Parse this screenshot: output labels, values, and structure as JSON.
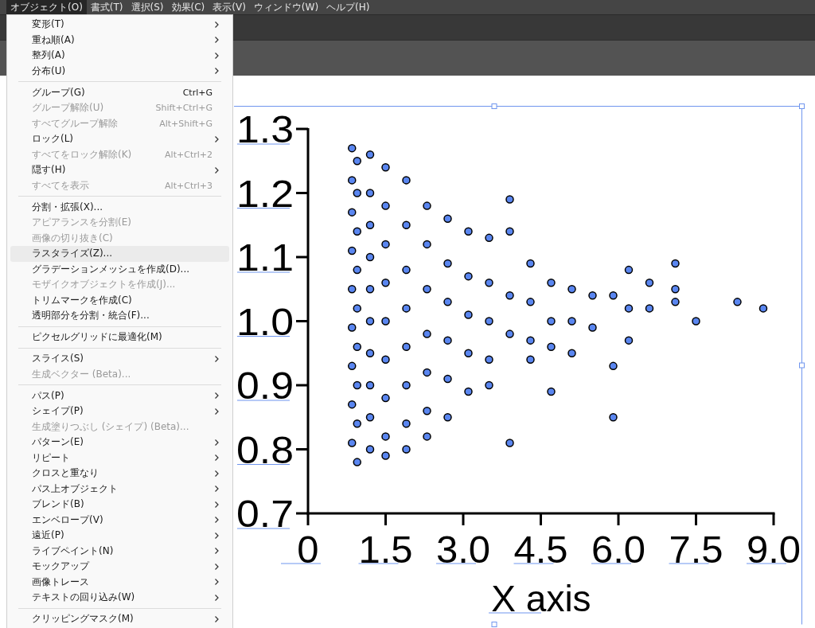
{
  "menubar": [
    {
      "label": "オブジェクト(O)",
      "selected": true
    },
    {
      "label": "書式(T)",
      "selected": false
    },
    {
      "label": "選択(S)",
      "selected": false
    },
    {
      "label": "効果(C)",
      "selected": false
    },
    {
      "label": "表示(V)",
      "selected": false
    },
    {
      "label": "ウィンドウ(W)",
      "selected": false
    },
    {
      "label": "ヘルプ(H)",
      "selected": false
    }
  ],
  "object_menu": [
    {
      "kind": "item",
      "label": "変形(T)",
      "submenu": true,
      "disabled": false,
      "selected": false
    },
    {
      "kind": "item",
      "label": "重ね順(A)",
      "submenu": true,
      "disabled": false,
      "selected": false
    },
    {
      "kind": "item",
      "label": "整列(A)",
      "submenu": true,
      "disabled": false,
      "selected": false
    },
    {
      "kind": "item",
      "label": "分布(U)",
      "submenu": true,
      "disabled": false,
      "selected": false
    },
    {
      "kind": "separator"
    },
    {
      "kind": "item",
      "label": "グループ(G)",
      "shortcut": "Ctrl+G",
      "submenu": false,
      "disabled": false,
      "selected": false
    },
    {
      "kind": "item",
      "label": "グループ解除(U)",
      "shortcut": "Shift+Ctrl+G",
      "submenu": false,
      "disabled": true,
      "selected": false
    },
    {
      "kind": "item",
      "label": "すべてグループ解除",
      "shortcut": "Alt+Shift+G",
      "submenu": false,
      "disabled": true,
      "selected": false
    },
    {
      "kind": "item",
      "label": "ロック(L)",
      "submenu": true,
      "disabled": false,
      "selected": false
    },
    {
      "kind": "item",
      "label": "すべてをロック解除(K)",
      "shortcut": "Alt+Ctrl+2",
      "submenu": false,
      "disabled": true,
      "selected": false
    },
    {
      "kind": "item",
      "label": "隠す(H)",
      "submenu": true,
      "disabled": false,
      "selected": false
    },
    {
      "kind": "item",
      "label": "すべてを表示",
      "shortcut": "Alt+Ctrl+3",
      "submenu": false,
      "disabled": true,
      "selected": false
    },
    {
      "kind": "separator"
    },
    {
      "kind": "item",
      "label": "分割・拡張(X)...",
      "submenu": false,
      "disabled": false,
      "selected": false
    },
    {
      "kind": "item",
      "label": "アピアランスを分割(E)",
      "submenu": false,
      "disabled": true,
      "selected": false
    },
    {
      "kind": "item",
      "label": "画像の切り抜き(C)",
      "submenu": false,
      "disabled": true,
      "selected": false
    },
    {
      "kind": "item",
      "label": "ラスタライズ(Z)...",
      "submenu": false,
      "disabled": false,
      "selected": true
    },
    {
      "kind": "item",
      "label": "グラデーションメッシュを作成(D)...",
      "submenu": false,
      "disabled": false,
      "selected": false
    },
    {
      "kind": "item",
      "label": "モザイクオブジェクトを作成(J)...",
      "submenu": false,
      "disabled": true,
      "selected": false
    },
    {
      "kind": "item",
      "label": "トリムマークを作成(C)",
      "submenu": false,
      "disabled": false,
      "selected": false
    },
    {
      "kind": "item",
      "label": "透明部分を分割・統合(F)...",
      "submenu": false,
      "disabled": false,
      "selected": false
    },
    {
      "kind": "separator"
    },
    {
      "kind": "item",
      "label": "ピクセルグリッドに最適化(M)",
      "submenu": false,
      "disabled": false,
      "selected": false
    },
    {
      "kind": "separator"
    },
    {
      "kind": "item",
      "label": "スライス(S)",
      "submenu": true,
      "disabled": false,
      "selected": false
    },
    {
      "kind": "item",
      "label": "生成ベクター (Beta)...",
      "submenu": false,
      "disabled": true,
      "selected": false
    },
    {
      "kind": "separator"
    },
    {
      "kind": "item",
      "label": "パス(P)",
      "submenu": true,
      "disabled": false,
      "selected": false
    },
    {
      "kind": "item",
      "label": "シェイプ(P)",
      "submenu": true,
      "disabled": false,
      "selected": false
    },
    {
      "kind": "item",
      "label": "生成塗りつぶし (シェイプ) (Beta)...",
      "submenu": false,
      "disabled": true,
      "selected": false
    },
    {
      "kind": "item",
      "label": "パターン(E)",
      "submenu": true,
      "disabled": false,
      "selected": false
    },
    {
      "kind": "item",
      "label": "リピート",
      "submenu": true,
      "disabled": false,
      "selected": false
    },
    {
      "kind": "item",
      "label": "クロスと重なり",
      "submenu": true,
      "disabled": false,
      "selected": false
    },
    {
      "kind": "item",
      "label": "パス上オブジェクト",
      "submenu": true,
      "disabled": false,
      "selected": false
    },
    {
      "kind": "item",
      "label": "ブレンド(B)",
      "submenu": true,
      "disabled": false,
      "selected": false
    },
    {
      "kind": "item",
      "label": "エンベロープ(V)",
      "submenu": true,
      "disabled": false,
      "selected": false
    },
    {
      "kind": "item",
      "label": "遠近(P)",
      "submenu": true,
      "disabled": false,
      "selected": false
    },
    {
      "kind": "item",
      "label": "ライブペイント(N)",
      "submenu": true,
      "disabled": false,
      "selected": false
    },
    {
      "kind": "item",
      "label": "モックアップ",
      "submenu": true,
      "disabled": false,
      "selected": false
    },
    {
      "kind": "item",
      "label": "画像トレース",
      "submenu": true,
      "disabled": false,
      "selected": false
    },
    {
      "kind": "item",
      "label": "テキストの回り込み(W)",
      "submenu": true,
      "disabled": false,
      "selected": false
    },
    {
      "kind": "separator"
    },
    {
      "kind": "item",
      "label": "クリッピングマスク(M)",
      "submenu": true,
      "disabled": false,
      "selected": false
    }
  ],
  "canvas": {
    "chart_data": {
      "type": "scatter",
      "xlabel": "X axis",
      "xlim": [
        0,
        9
      ],
      "ylim": [
        0.7,
        1.3
      ],
      "xticks": [
        {
          "value": 0,
          "label": "0"
        },
        {
          "value": 1.5,
          "label": "1.5"
        },
        {
          "value": 3,
          "label": "3.0"
        },
        {
          "value": 4.5,
          "label": "4.5"
        },
        {
          "value": 6,
          "label": "6.0"
        },
        {
          "value": 7.5,
          "label": "7.5"
        },
        {
          "value": 9,
          "label": "9.0"
        }
      ],
      "yticks": [
        {
          "value": 0.7,
          "label": "0.7"
        },
        {
          "value": 0.8,
          "label": "0.8"
        },
        {
          "value": 0.9,
          "label": "0.9"
        },
        {
          "value": 1.0,
          "label": "1.0"
        },
        {
          "value": 1.1,
          "label": "1.1"
        },
        {
          "value": 1.2,
          "label": "1.2"
        },
        {
          "value": 1.3,
          "label": "1.3"
        }
      ],
      "x": [
        0.85,
        0.95,
        0.85,
        0.95,
        0.85,
        0.95,
        0.85,
        0.95,
        0.85,
        0.95,
        0.85,
        0.95,
        0.85,
        0.95,
        0.85,
        0.95,
        0.85,
        0.95,
        1.2,
        1.2,
        1.2,
        1.2,
        1.2,
        1.2,
        1.2,
        1.2,
        1.2,
        1.2,
        1.5,
        1.5,
        1.5,
        1.5,
        1.5,
        1.5,
        1.5,
        1.5,
        1.5,
        1.9,
        1.9,
        1.9,
        1.9,
        1.9,
        1.9,
        1.9,
        1.9,
        2.3,
        2.3,
        2.3,
        2.3,
        2.3,
        2.3,
        2.3,
        2.7,
        2.7,
        2.7,
        2.7,
        2.7,
        2.7,
        3.1,
        3.1,
        3.1,
        3.1,
        3.1,
        3.5,
        3.5,
        3.5,
        3.5,
        3.5,
        3.9,
        3.9,
        3.9,
        3.9,
        3.9,
        4.3,
        4.3,
        4.3,
        4.3,
        4.7,
        4.7,
        4.7,
        4.7,
        5.1,
        5.1,
        5.1,
        5.5,
        5.5,
        5.9,
        5.9,
        5.9,
        6.2,
        6.2,
        6.2,
        6.6,
        6.6,
        7.1,
        7.1,
        7.1,
        7.5,
        8.3,
        8.8
      ],
      "series": [
        {
          "color": "#5a86f0",
          "values": [
            1.27,
            1.25,
            1.22,
            1.2,
            1.17,
            1.14,
            1.11,
            1.08,
            1.05,
            1.02,
            0.99,
            0.96,
            0.93,
            0.9,
            0.87,
            0.84,
            0.81,
            0.78,
            1.26,
            1.2,
            1.15,
            1.1,
            1.05,
            1.0,
            0.95,
            0.9,
            0.85,
            0.8,
            1.24,
            1.18,
            1.12,
            1.06,
            1.0,
            0.94,
            0.88,
            0.82,
            0.79,
            1.22,
            1.15,
            1.08,
            1.02,
            0.96,
            0.9,
            0.84,
            0.8,
            1.18,
            1.12,
            1.05,
            0.98,
            0.92,
            0.86,
            0.82,
            1.16,
            1.09,
            1.03,
            0.97,
            0.91,
            0.85,
            1.14,
            1.07,
            1.01,
            0.95,
            0.89,
            1.13,
            1.06,
            1.0,
            0.94,
            0.9,
            1.19,
            1.14,
            1.04,
            0.98,
            0.81,
            1.09,
            1.03,
            0.97,
            0.94,
            1.06,
            1.0,
            0.96,
            0.89,
            1.05,
            1.0,
            0.95,
            1.04,
            0.99,
            1.04,
            0.93,
            0.85,
            1.08,
            1.02,
            0.97,
            1.06,
            1.02,
            1.09,
            1.05,
            1.03,
            1.0,
            1.03,
            1.02
          ]
        }
      ]
    }
  }
}
